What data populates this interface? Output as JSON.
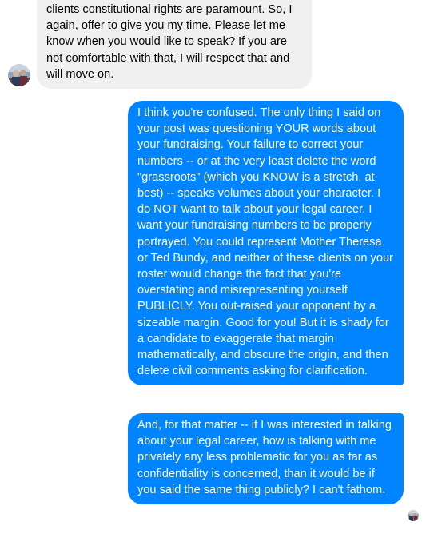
{
  "conversation": {
    "incoming": {
      "text": "clients constitutional rights are paramount.  So, I again, offer to give you my time.  Please let me know when you would like to speak?  If you are not comfortable with that, I will respect that and will move on."
    },
    "outgoing": [
      {
        "text": "I think you're confused. The only thing I said on your post was questioning YOUR words about your fundraising. Your failure to correct your numbers -- or at the very least delete the word \"grassroots\" (which you KNOW is a stretch, at best) -- speaks volumes about your character. I do NOT want to talk about your legal career. I want your fundraising numbers to be properly portrayed. You could represent Mother Theresa or Ted Bundy, and neither of these clients on your roster would change the fact that you're overstating and misrepresenting yourself PUBLICLY. You out-raised your opponent by a sizeable margin. Good for you! But it is shady for a candidate to exaggerate that margin mathematically, and obscure the origin, and then delete civil comments asking for clarification."
      },
      {
        "text": "And, for that matter -- if I was interested in talking about your legal career, how is talking with me privately any less problematic for you as far as confidentiality is concerned, than it would be if you said the same thing publicly? I can't fathom."
      }
    ]
  },
  "colors": {
    "outgoing_bubble": "#0084ff",
    "incoming_bubble": "#f0f0f0",
    "incoming_text": "#050505",
    "outgoing_text": "#ffffff"
  },
  "icons": {
    "contact_avatar": "avatar-icon",
    "seen_indicator": "seen-avatar-icon"
  }
}
